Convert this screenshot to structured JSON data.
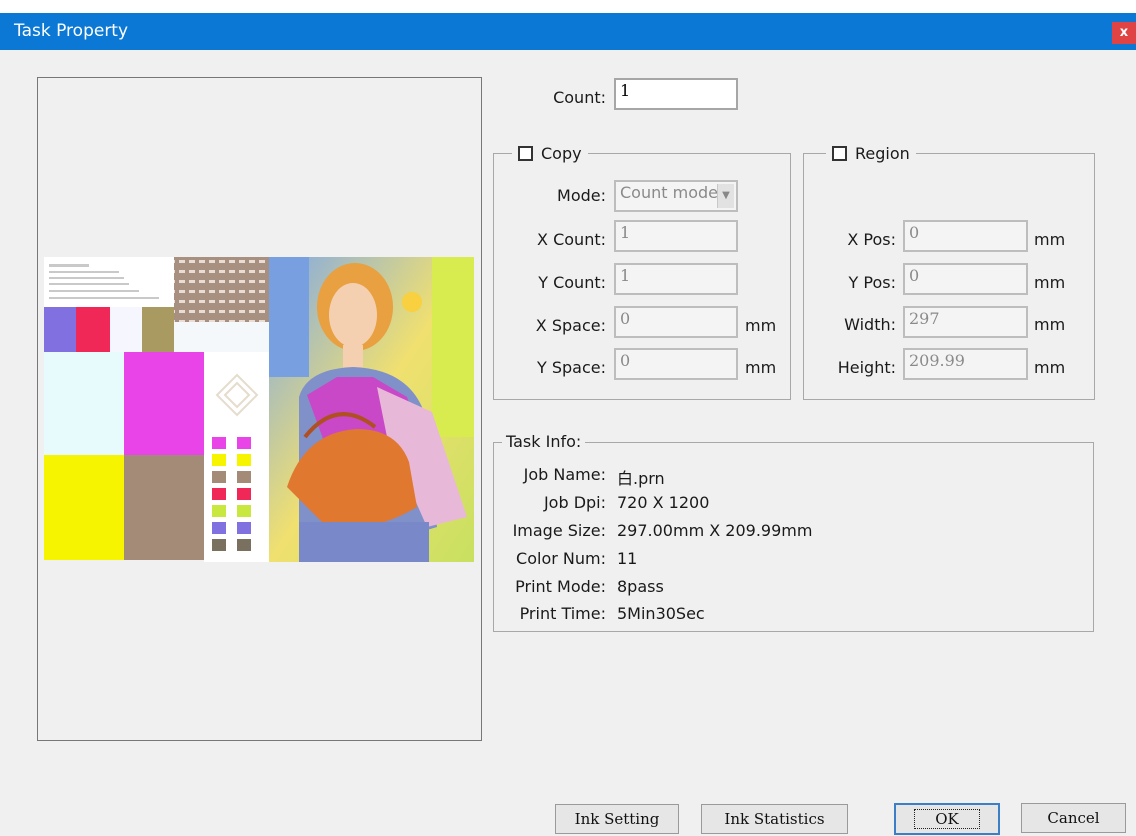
{
  "window": {
    "title": "Task Property",
    "close_label": "x"
  },
  "count": {
    "label": "Count:",
    "value": "1"
  },
  "copy": {
    "label": "Copy",
    "mode_label": "Mode:",
    "mode_value": "Count mode",
    "x_count_label": "X Count:",
    "x_count_value": "1",
    "y_count_label": "Y Count:",
    "y_count_value": "1",
    "x_space_label": "X Space:",
    "x_space_value": "0",
    "y_space_label": "Y Space:",
    "y_space_value": "0",
    "unit": "mm"
  },
  "region": {
    "label": "Region",
    "x_pos_label": "X Pos:",
    "x_pos_value": "0",
    "y_pos_label": "Y Pos:",
    "y_pos_value": "0",
    "width_label": "Width:",
    "width_value": "297",
    "height_label": "Height:",
    "height_value": "209.99",
    "unit": "mm"
  },
  "task_info": {
    "label": "Task Info:",
    "rows": [
      {
        "label": "Job Name:",
        "value": "白.prn"
      },
      {
        "label": "Job Dpi:",
        "value": "720 X 1200"
      },
      {
        "label": "Image Size:",
        "value": "297.00mm X 209.99mm"
      },
      {
        "label": "Color Num:",
        "value": "11"
      },
      {
        "label": "Print Mode:",
        "value": "8pass"
      },
      {
        "label": "Print Time:",
        "value": "5Min30Sec"
      }
    ]
  },
  "buttons": {
    "ink_setting": "Ink Setting",
    "ink_statistics": "Ink Statistics",
    "ok": "OK",
    "cancel": "Cancel"
  },
  "colors": {
    "titlebar": "#0a78d4",
    "close": "#e04343",
    "magenta": "#e844e8",
    "yellow": "#f7f400",
    "cyan_light": "#e8fbfc",
    "brown": "#a48b78",
    "violet": "#8070e0",
    "red": "#f02858"
  }
}
